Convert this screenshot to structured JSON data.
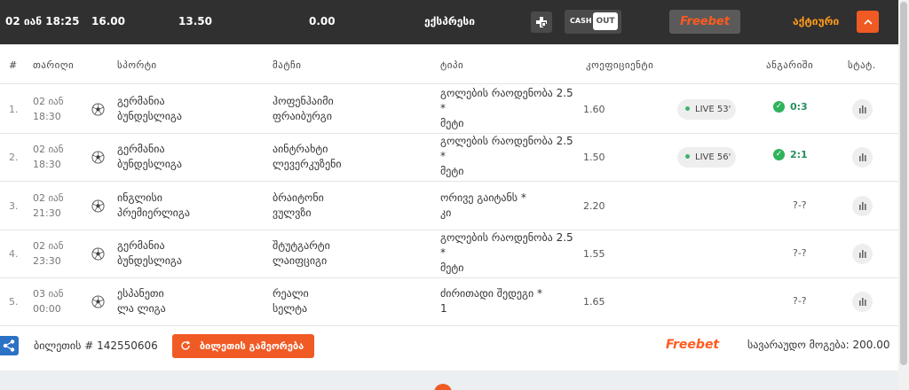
{
  "topbar": {
    "datetime": "02 იან 18:25",
    "stake": "16.00",
    "odds": "13.50",
    "win": "0.00",
    "type": "ექსპრესი",
    "cash_label": "CASH",
    "out_label": "OUT",
    "freebet_label": "Freebet",
    "status": "აქტიური",
    "icons": [
      "add-square-icon",
      "chevron-up-icon"
    ]
  },
  "columns": {
    "index": "#",
    "date": "თარიღი",
    "sport": "სპორტი",
    "match": "მატჩი",
    "type": "ტიპი",
    "coef": "კოეფიციენტი",
    "result": "ანგარიში",
    "stat": "სტატ."
  },
  "rows": [
    {
      "num": "1.",
      "date": "02 იან",
      "time": "18:30",
      "league1": "გერმანია",
      "league2": "ბუნდესლიგა",
      "team1": "ჰოფენჰაიმი",
      "team2": "ფრაიბურგი",
      "type1": "გოლების რაოდენობა 2.5",
      "type2": "*",
      "type3": "მეტი",
      "coef": "1.60",
      "live": "LIVE 53'",
      "result": "0:3",
      "status": "won"
    },
    {
      "num": "2.",
      "date": "02 იან",
      "time": "18:30",
      "league1": "გერმანია",
      "league2": "ბუნდესლიგა",
      "team1": "აინტრახტი",
      "team2": "ლევერკუზენი",
      "type1": "გოლების რაოდენობა 2.5",
      "type2": "*",
      "type3": "მეტი",
      "coef": "1.50",
      "live": "LIVE 56'",
      "result": "2:1",
      "status": "won"
    },
    {
      "num": "3.",
      "date": "02 იან",
      "time": "21:30",
      "league1": "ინგლისი",
      "league2": "პრემიერლიგა",
      "team1": "ბრაიტონი",
      "team2": "ვულვზი",
      "type1": "ორივე გაიტანს *",
      "type2": "კი",
      "type3": "",
      "coef": "2.20",
      "live": "",
      "result": "?-?",
      "status": "pending"
    },
    {
      "num": "4.",
      "date": "02 იან",
      "time": "23:30",
      "league1": "გერმანია",
      "league2": "ბუნდესლიგა",
      "team1": "შტუტგარტი",
      "team2": "ლაიფციგი",
      "type1": "გოლების რაოდენობა 2.5",
      "type2": "*",
      "type3": "მეტი",
      "coef": "1.55",
      "live": "",
      "result": "?-?",
      "status": "pending"
    },
    {
      "num": "5.",
      "date": "03 იან",
      "time": "00:00",
      "league1": "ესპანეთი",
      "league2": "ლა ლიგა",
      "team1": "რეალი",
      "team2": "სელტა",
      "type1": "ძირითადი შედეგი *",
      "type2": "1",
      "type3": "",
      "coef": "1.65",
      "live": "",
      "result": "?-?",
      "status": "pending"
    }
  ],
  "footer": {
    "ticket_label": "ბილეთის # 142550606",
    "repeat_label": "ბილეთის გამეორება",
    "freebet_label": "Freebet",
    "payout_label": "სავარაუდო მოგება: 200.00"
  },
  "colors": {
    "accent": "#f05a24",
    "dark": "#303030",
    "status_active": "#ff9a1a",
    "win_green": "#2fb35b",
    "share_blue": "#2b72c6"
  }
}
